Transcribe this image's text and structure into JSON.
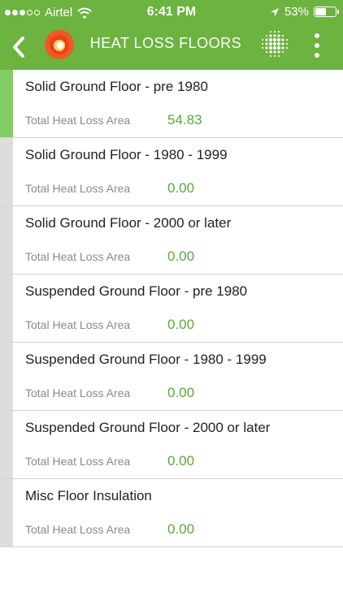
{
  "status": {
    "carrier": "Airtel",
    "time": "6:41 PM",
    "battery": "53%",
    "battery_level": 0.53
  },
  "header": {
    "title": "HEAT LOSS FLOORS"
  },
  "colors": {
    "brand_green": "#6db33f",
    "value_green": "#5aa83c",
    "active_indicator": "#82cc64",
    "logo_orange": "#f05a22"
  },
  "icons": {
    "back": "chevron-left-icon",
    "logo": "flame-logo-icon",
    "grid": "dot-grid-icon",
    "menu": "more-vertical-icon"
  },
  "floors": [
    {
      "name": "Solid Ground Floor - pre 1980",
      "label": "Total Heat Loss Area",
      "value": "54.83",
      "active": true
    },
    {
      "name": "Solid Ground Floor - 1980 - 1999",
      "label": "Total Heat Loss Area",
      "value": "0.00",
      "active": false
    },
    {
      "name": "Solid Ground Floor - 2000 or later",
      "label": "Total Heat Loss Area",
      "value": "0.00",
      "active": false
    },
    {
      "name": "Suspended Ground Floor - pre 1980",
      "label": "Total Heat Loss Area",
      "value": "0.00",
      "active": false
    },
    {
      "name": "Suspended Ground Floor - 1980 - 1999",
      "label": "Total Heat Loss Area",
      "value": "0.00",
      "active": false
    },
    {
      "name": "Suspended Ground Floor - 2000 or later",
      "label": "Total Heat Loss Area",
      "value": "0.00",
      "active": false
    },
    {
      "name": "Misc Floor Insulation",
      "label": "Total Heat Loss Area",
      "value": "0.00",
      "active": false
    }
  ]
}
